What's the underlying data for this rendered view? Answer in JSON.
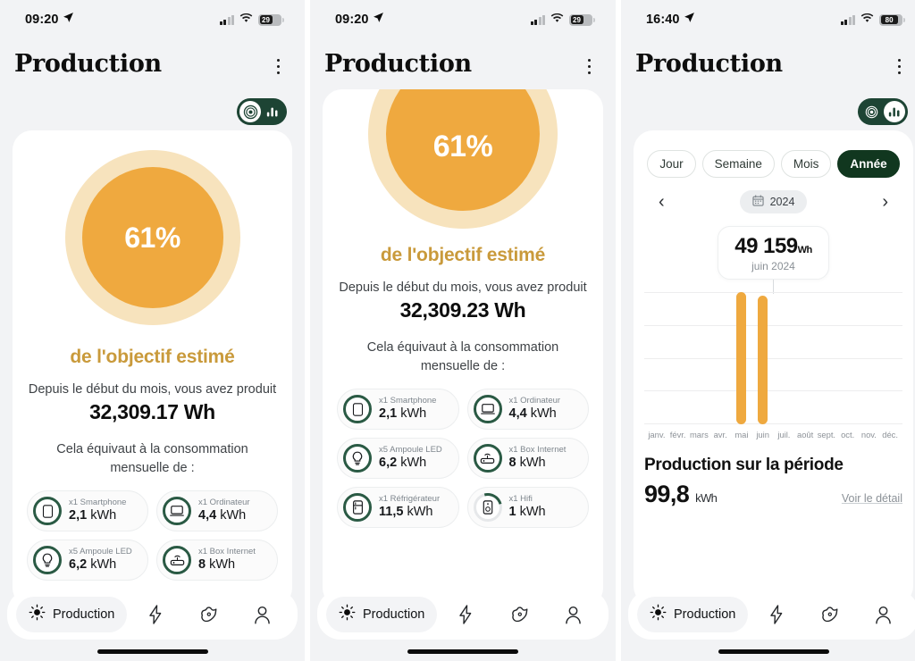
{
  "panels": [
    {
      "status": {
        "time": "09:20",
        "battery": "29",
        "location_icon": "location-arrow-icon",
        "signal_icon": "cellular-signal-icon",
        "wifi_icon": "wifi-icon"
      },
      "header": {
        "title": "Production",
        "menu_icon": "kebab-menu-icon"
      },
      "toggle": {
        "position": "left",
        "left_icon": "solar-target-icon",
        "right_icon": "bar-chart-icon"
      },
      "donut": {
        "percent": "61%",
        "track_color": "#f7e3bd",
        "fill_color": "#efa93f"
      },
      "goal_label": "de l'objectif estimé",
      "since_label": "Depuis le début du mois, vous avez produit",
      "total_value": "32,309.17 Wh",
      "equiv_label": "Cela équivaut à la consommation mensuelle de :",
      "appliances": [
        {
          "name": "x1 Smartphone",
          "value": "2,1",
          "unit": "kWh",
          "icon": "smartphone-icon",
          "complete": true
        },
        {
          "name": "x1 Ordinateur",
          "value": "4,4",
          "unit": "kWh",
          "icon": "computer-icon",
          "complete": true
        },
        {
          "name": "x5 Ampoule LED",
          "value": "6,2",
          "unit": "kWh",
          "icon": "lightbulb-icon",
          "complete": true
        },
        {
          "name": "x1 Box Internet",
          "value": "8",
          "unit": "kWh",
          "icon": "router-icon",
          "complete": true
        }
      ],
      "tabs": {
        "active_label": "Production",
        "active_icon": "sun-icon",
        "icons": [
          "bolt-icon",
          "tag-icon",
          "user-icon"
        ]
      }
    },
    {
      "status": {
        "time": "09:20",
        "battery": "29",
        "location_icon": "location-arrow-icon",
        "signal_icon": "cellular-signal-icon",
        "wifi_icon": "wifi-icon"
      },
      "header": {
        "title": "Production",
        "menu_icon": "kebab-menu-icon"
      },
      "donut": {
        "percent": "61%",
        "track_color": "#f7e3bd",
        "fill_color": "#efa93f"
      },
      "goal_label": "de l'objectif estimé",
      "since_label": "Depuis le début du mois, vous avez produit",
      "total_value": "32,309.23 Wh",
      "equiv_label": "Cela équivaut à la consommation mensuelle de :",
      "appliances": [
        {
          "name": "x1 Smartphone",
          "value": "2,1",
          "unit": "kWh",
          "icon": "smartphone-icon",
          "complete": true
        },
        {
          "name": "x1 Ordinateur",
          "value": "4,4",
          "unit": "kWh",
          "icon": "computer-icon",
          "complete": true
        },
        {
          "name": "x5 Ampoule LED",
          "value": "6,2",
          "unit": "kWh",
          "icon": "lightbulb-icon",
          "complete": true
        },
        {
          "name": "x1 Box Internet",
          "value": "8",
          "unit": "kWh",
          "icon": "router-icon",
          "complete": true
        },
        {
          "name": "x1 Réfrigérateur",
          "value": "11,5",
          "unit": "kWh",
          "icon": "fridge-icon",
          "complete": true
        },
        {
          "name": "x1 Hifi",
          "value": "1",
          "unit": "kWh",
          "icon": "speaker-icon",
          "complete": false
        }
      ],
      "tabs": {
        "active_label": "Production",
        "active_icon": "sun-icon",
        "icons": [
          "bolt-icon",
          "tag-icon",
          "user-icon"
        ]
      }
    },
    {
      "status": {
        "time": "16:40",
        "battery": "80",
        "location_icon": "location-arrow-icon",
        "signal_icon": "cellular-signal-icon",
        "wifi_icon": "wifi-icon"
      },
      "header": {
        "title": "Production",
        "menu_icon": "kebab-menu-icon"
      },
      "toggle": {
        "position": "right",
        "left_icon": "solar-target-icon",
        "right_icon": "bar-chart-icon"
      },
      "periods": [
        {
          "label": "Jour",
          "active": false
        },
        {
          "label": "Semaine",
          "active": false
        },
        {
          "label": "Mois",
          "active": false
        },
        {
          "label": "Année",
          "active": true
        }
      ],
      "year_nav": {
        "prev_icon": "chevron-left-icon",
        "next_icon": "chevron-right-icon",
        "calendar_icon": "calendar-icon",
        "year": "2024"
      },
      "tooltip": {
        "value": "49 159",
        "unit": "Wh",
        "period": "juin 2024"
      },
      "summary": {
        "title": "Production sur la période",
        "value": "99,8",
        "unit": "kWh",
        "detail_link": "Voir le détail"
      },
      "tabs": {
        "active_label": "Production",
        "active_icon": "sun-icon",
        "icons": [
          "bolt-icon",
          "tag-icon",
          "user-icon"
        ]
      }
    }
  ],
  "chart_data": {
    "type": "bar",
    "title": "Production sur la période",
    "categories": [
      "janv.",
      "févr.",
      "mars",
      "avr.",
      "mai",
      "juin",
      "juil.",
      "août",
      "sept.",
      "oct.",
      "nov.",
      "déc."
    ],
    "values": [
      0,
      0,
      0,
      0,
      50641,
      49159,
      0,
      0,
      0,
      0,
      0,
      0
    ],
    "series": [
      {
        "name": "Production",
        "values": [
          0,
          0,
          0,
          0,
          50641,
          49159,
          0,
          0,
          0,
          0,
          0,
          0
        ]
      }
    ],
    "xlabel": "",
    "ylabel": "Wh",
    "ylim": [
      0,
      60000
    ],
    "grid": true,
    "gridlines": 5,
    "legend": "none",
    "bar_color": "#efa93f",
    "highlighted_category": "juin",
    "annotation": "49 159 Wh — juin 2024",
    "unit": "Wh"
  }
}
